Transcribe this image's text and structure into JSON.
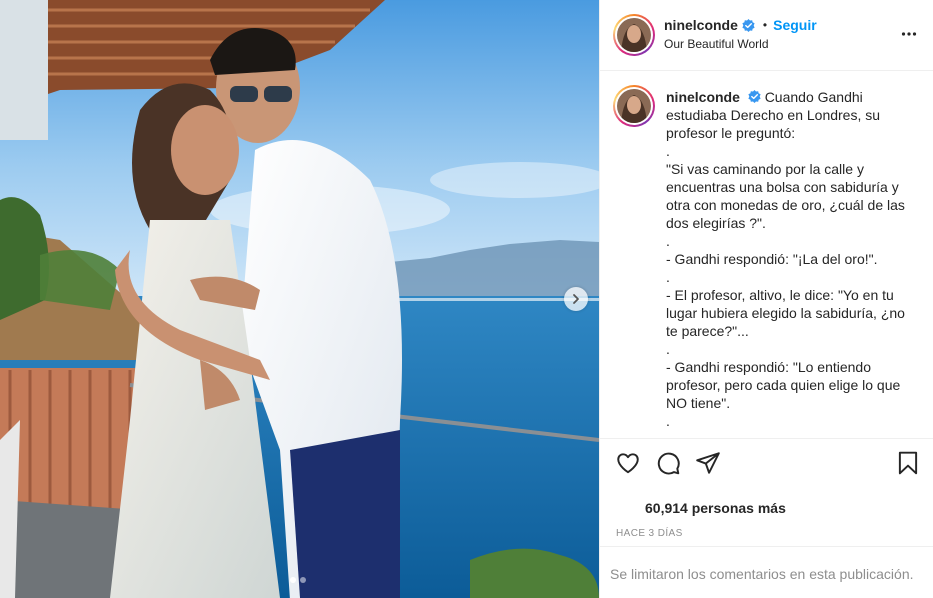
{
  "post": {
    "username": "ninelconde",
    "follow_label": "Seguir",
    "separator": "•",
    "location": "Our Beautiful World",
    "caption_lines": [
      "Cuando Gandhi",
      "estudiaba Derecho en Londres, su",
      "profesor le preguntó:",
      ".",
      "\"Si vas caminando por la calle y",
      "encuentras una bolsa con sabiduría y",
      "otra con monedas de oro, ¿cuál de las",
      "dos elegirías ?\".",
      ".",
      "- Gandhi respondió: \"¡La del oro!\".",
      ".",
      "- El profesor, altivo, le dice: \"Yo en tu",
      "lugar hubiera elegido la sabiduría, ¿no",
      "te parece?\"...",
      ".",
      "- Gandhi respondió: \"Lo entiendo",
      "profesor, pero cada quien elige lo que",
      "NO tiene\".",
      "."
    ],
    "likes_text": "60,914 personas más",
    "time_text": "HACE 3 DÍAS",
    "comments_disabled_text": "Se limitaron los comentarios en esta publicación.",
    "carousel": {
      "total": 2,
      "current": 1
    }
  },
  "icons": {
    "verified": "verified-badge-icon",
    "more": "more-options-icon",
    "like": "heart-icon",
    "comment": "comment-icon",
    "share": "share-icon",
    "save": "bookmark-icon",
    "next": "chevron-right-icon"
  },
  "colors": {
    "accent": "#0095f6",
    "text": "#262626",
    "muted": "#8e8e8e",
    "border": "#efefef"
  }
}
